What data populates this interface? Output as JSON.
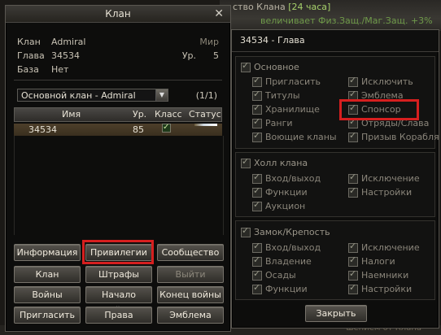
{
  "background": {
    "line1_prefix": "ство Клана ",
    "line1_highlight": "[24 часа]",
    "line2": "величивает Физ.Защ./Маг.Защ. +3%",
    "bottom_ghost": "шением от Клана"
  },
  "clan_window": {
    "title": "Клан",
    "close": "✕",
    "info": [
      {
        "label": "Клан",
        "value": "Admiral",
        "right_label": "Мир",
        "right_value": ""
      },
      {
        "label": "Глава",
        "value": "34534",
        "right_label": "Ур.",
        "right_value": "5"
      },
      {
        "label": "База",
        "value": "Нет",
        "right_label": "",
        "right_value": ""
      }
    ],
    "select_value": "Основной клан - Admiral",
    "pager": "(1/1)",
    "table": {
      "headers": {
        "name": "Имя",
        "level": "Ур.",
        "class": "Класс",
        "status": "Статус"
      },
      "rows": [
        {
          "name": "34534",
          "level": "85"
        }
      ]
    },
    "buttons": {
      "info": "Информация",
      "privileges": "Привилегии",
      "community": "Сообщество",
      "clan": "Клан",
      "fines": "Штрафы",
      "leave": "Выйти",
      "wars": "Войны",
      "start_war": "Начало войны",
      "end_war": "Конец войны",
      "invite": "Пригласить",
      "rights": "Права",
      "emblem": "Эмблема"
    }
  },
  "privileges_window": {
    "header": "34534 - Глава",
    "group_basic": {
      "title": "Основное",
      "left": [
        "Пригласить",
        "Титулы",
        "Хранилище",
        "Ранги",
        "Воющие кланы"
      ],
      "right": [
        "Исключить",
        "Эмблема",
        "Спонсор",
        "Отряды/Слава",
        "Призыв Корабля"
      ]
    },
    "group_hall": {
      "title": "Холл клана",
      "left": [
        "Вход/выход",
        "Функции",
        "Аукцион"
      ],
      "right": [
        "Исключение",
        "Настройки"
      ]
    },
    "group_castle": {
      "title": "Замок/Крепость",
      "left": [
        "Вход/выход",
        "Владение",
        "Осады",
        "Функции"
      ],
      "right": [
        "Исключение",
        "Налоги",
        "Наемники",
        "Настройки"
      ]
    },
    "close_button": "Закрыть"
  },
  "colors": {
    "highlight_box": "#d61f1f",
    "accent_green": "#a6d06b"
  }
}
